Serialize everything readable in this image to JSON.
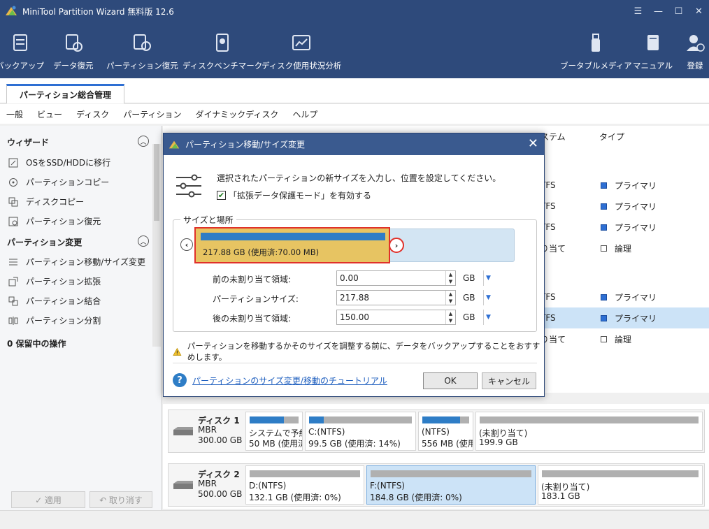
{
  "app": {
    "title": "MiniTool Partition Wizard 無料版 12.6"
  },
  "window_controls": [
    "☰",
    "—",
    "☐",
    "✕"
  ],
  "toolbar": {
    "left": [
      {
        "label": "バックアップ",
        "icon": "backup-icon"
      },
      {
        "label": "データ復元",
        "icon": "data-recovery-icon"
      },
      {
        "label": "パーティション復元",
        "icon": "partition-recovery-icon"
      },
      {
        "label": "ディスクベンチマーク",
        "icon": "disk-benchmark-icon"
      },
      {
        "label": "ディスク使用状況分析",
        "icon": "space-analyzer-icon"
      }
    ],
    "right": [
      {
        "label": "ブータブルメディア",
        "icon": "bootable-media-icon"
      },
      {
        "label": "マニュアル",
        "icon": "manual-icon"
      },
      {
        "label": "登録",
        "icon": "register-icon"
      }
    ]
  },
  "tab": {
    "label": "パーティション総合管理"
  },
  "menu": [
    "一般",
    "ビュー",
    "ディスク",
    "パーティション",
    "ダイナミックディスク",
    "ヘルプ"
  ],
  "sidebar": {
    "wizard_header": "ウィザード",
    "wizard_items": [
      "OSをSSD/HDDに移行",
      "パーティションコピー",
      "ディスクコピー",
      "パーティション復元"
    ],
    "change_header": "パーティション変更",
    "change_items": [
      "パーティション移動/サイズ変更",
      "パーティション拡張",
      "パーティション結合",
      "パーティション分割"
    ],
    "pending": "0 保留中の操作",
    "apply": "✓ 適用",
    "undo": "↶ 取り消す"
  },
  "table": {
    "headers": {
      "fs": "ステム",
      "type": "タイプ"
    },
    "rows": [
      {
        "fs": "TFS",
        "type": "プライマリ",
        "color": "#2e6fd3",
        "selected": false
      },
      {
        "fs": "TFS",
        "type": "プライマリ",
        "color": "#2e6fd3",
        "selected": false
      },
      {
        "fs": "TFS",
        "type": "プライマリ",
        "color": "#2e6fd3",
        "selected": false
      },
      {
        "fs": "り当て",
        "type": "論理",
        "color": "#ffffff",
        "selected": false
      },
      {
        "fs": "TFS",
        "type": "プライマリ",
        "color": "#2e6fd3",
        "selected": false
      },
      {
        "fs": "TFS",
        "type": "プライマリ",
        "color": "#2e6fd3",
        "selected": true
      },
      {
        "fs": "り当て",
        "type": "論理",
        "color": "#ffffff",
        "selected": false
      }
    ]
  },
  "disks": [
    {
      "name": "ディスク 1",
      "scheme": "MBR",
      "size": "300.00 GB",
      "partitions": [
        {
          "l1": "システムで予約",
          "l2": "50 MB (使用済",
          "used": 0.7,
          "selected": false
        },
        {
          "l1": "C:(NTFS)",
          "l2": "99.5 GB (使用済: 14%)",
          "used": 0.14,
          "selected": false
        },
        {
          "l1": "(NTFS)",
          "l2": "556 MB (使用",
          "used": 0.8,
          "selected": false
        },
        {
          "l1": "(未割り当て)",
          "l2": "199.9 GB",
          "used": 0,
          "selected": false
        }
      ]
    },
    {
      "name": "ディスク 2",
      "scheme": "MBR",
      "size": "500.00 GB",
      "partitions": [
        {
          "l1": "D:(NTFS)",
          "l2": "132.1 GB (使用済: 0%)",
          "used": 0.0,
          "selected": false
        },
        {
          "l1": "F:(NTFS)",
          "l2": "184.8 GB (使用済: 0%)",
          "used": 0.0,
          "selected": true
        },
        {
          "l1": "(未割り当て)",
          "l2": "183.1 GB",
          "used": 0,
          "selected": false
        }
      ]
    }
  ],
  "dialog": {
    "title": "パーティション移動/サイズ変更",
    "description": "選択されたパーティションの新サイズを入力し、位置を設定してください。",
    "checkbox_label": "「拡張データ保護モード」を有効する",
    "checkbox_checked": true,
    "group_label": "サイズと場所",
    "slider_text": "217.88 GB (使用済:70.00 MB)",
    "fields": [
      {
        "label": "前の未割り当て領域:",
        "value": "0.00",
        "unit": "GB"
      },
      {
        "label": "パーティションサイズ:",
        "value": "217.88",
        "unit": "GB"
      },
      {
        "label": "後の未割り当て領域:",
        "value": "150.00",
        "unit": "GB"
      }
    ],
    "warning": "パーティションを移動するかそのサイズを調整する前に、データをバックアップすることをおすすめします。",
    "help_link": "パーティションのサイズ変更/移動のチュートリアル",
    "ok": "OK",
    "cancel": "キャンセル"
  },
  "colors": {
    "titlebar": "#2e4a7b",
    "accent": "#2e7dc6",
    "partition": "#e7c462",
    "highlight": "#e0312a"
  }
}
